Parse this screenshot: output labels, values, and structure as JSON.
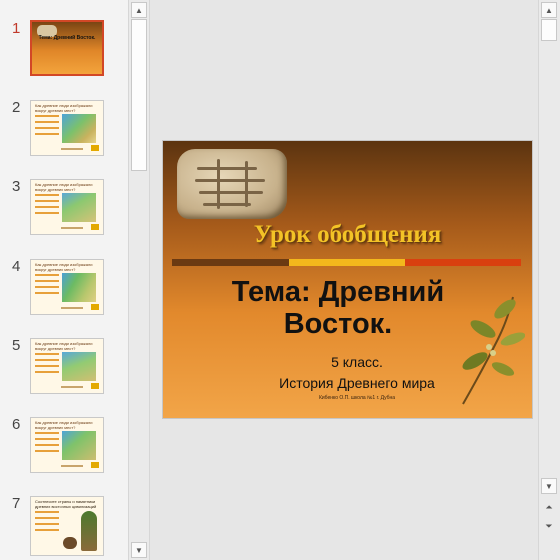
{
  "slide_numbers": [
    "1",
    "2",
    "3",
    "4",
    "5",
    "6",
    "7"
  ],
  "thumbnails": [
    {
      "title": "Тема: Древний Восток."
    },
    {
      "title": "Как древние люди изображали вокруг древних мест?"
    },
    {
      "title": "Как древние люди изображали вокруг древних мест?"
    },
    {
      "title": "Как древние люди изображали вокруг древних мест?"
    },
    {
      "title": "Как древние люди изображали вокруг древних мест?"
    },
    {
      "title": "Как древние люди изображали вокруг древних мест?"
    },
    {
      "title": "Соотнесите страны и памятники древних восточных цивилизаций"
    }
  ],
  "slide": {
    "lesson": "Урок обобщения",
    "theme_line1": "Тема: Древний",
    "theme_line2": "Восток.",
    "grade": "5 класс.",
    "subject": "История Древнего мира",
    "author": "Кибенко О.П. школа №1 г. Дубна"
  },
  "colors": {
    "accent": "#d24726",
    "bar_brown": "#6b3a12",
    "bar_yellow": "#f3b81c",
    "bar_red": "#d9400f",
    "title_gold": "#f3c326"
  },
  "icons": {
    "scroll_up": "triangle-up-icon",
    "scroll_down": "triangle-down-icon",
    "prev_slide": "double-chevron-up-icon",
    "next_slide": "double-chevron-down-icon"
  }
}
